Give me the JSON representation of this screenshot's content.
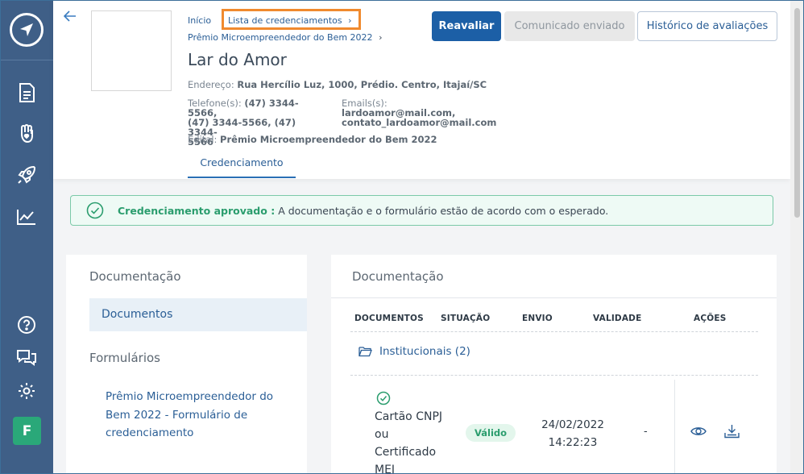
{
  "sidebar": {
    "avatar_letter": "F",
    "icons": [
      "compass-logo-icon",
      "document-icon",
      "hand-heart-icon",
      "rocket-icon",
      "chart-icon",
      "help-icon",
      "chat-icon",
      "gear-icon"
    ]
  },
  "breadcrumb": {
    "home": "Início",
    "list": "Lista de credenciamentos",
    "current": "Prêmio Microempreendedor do Bem 2022"
  },
  "organization": {
    "name": "Lar do Amor",
    "address_label": "Endereço:",
    "address": "Rua Hercílio Luz, 1000, Prédio. Centro, Itajaí/SC",
    "phone_label": "Telefone(s):",
    "phones_line1": "(47) 3344-5566,",
    "phones_line2": "(47) 3344-5566, (47) 3344-",
    "phones_line3": "5566",
    "emails_label": "Emails(s):",
    "email1": "lardoamor@mail.com,",
    "email2": "contato_lardoamor@mail.com",
    "edital_label": "Edital:",
    "edital": "Prêmio Microempreendedor do Bem 2022"
  },
  "tabs": {
    "credenciamento": "Credenciamento"
  },
  "actions": {
    "reavaliar": "Reavaliar",
    "comunicado": "Comunicado enviado",
    "historico": "Histórico de avaliações"
  },
  "alert": {
    "title": "Credenciamento aprovado :",
    "message": "A documentação e o formulário estão de acordo com o esperado."
  },
  "left_panel": {
    "documentation_title": "Documentação",
    "documents_item": "Documentos",
    "forms_title": "Formulários",
    "form_link": "Prêmio Microempreendedor do Bem 2022 - Formulário de credenciamento"
  },
  "right_panel": {
    "title": "Documentação",
    "columns": [
      "DOCUMENTOS",
      "SITUAÇÃO",
      "ENVIO",
      "VALIDADE",
      "AÇÕES"
    ],
    "folder": "Institucionais (2)",
    "rows": [
      {
        "name_lines": [
          "Cartão CNPJ",
          "ou",
          "Certificado",
          "MEI"
        ],
        "status": "Válido",
        "sent_date": "24/02/2022",
        "sent_time": "14:22:23",
        "validity": "-"
      }
    ]
  },
  "colors": {
    "sidebar": "#3f5f87",
    "primary": "#1c5fa6",
    "success": "#2b9d6e",
    "highlight": "#f08a2e"
  }
}
